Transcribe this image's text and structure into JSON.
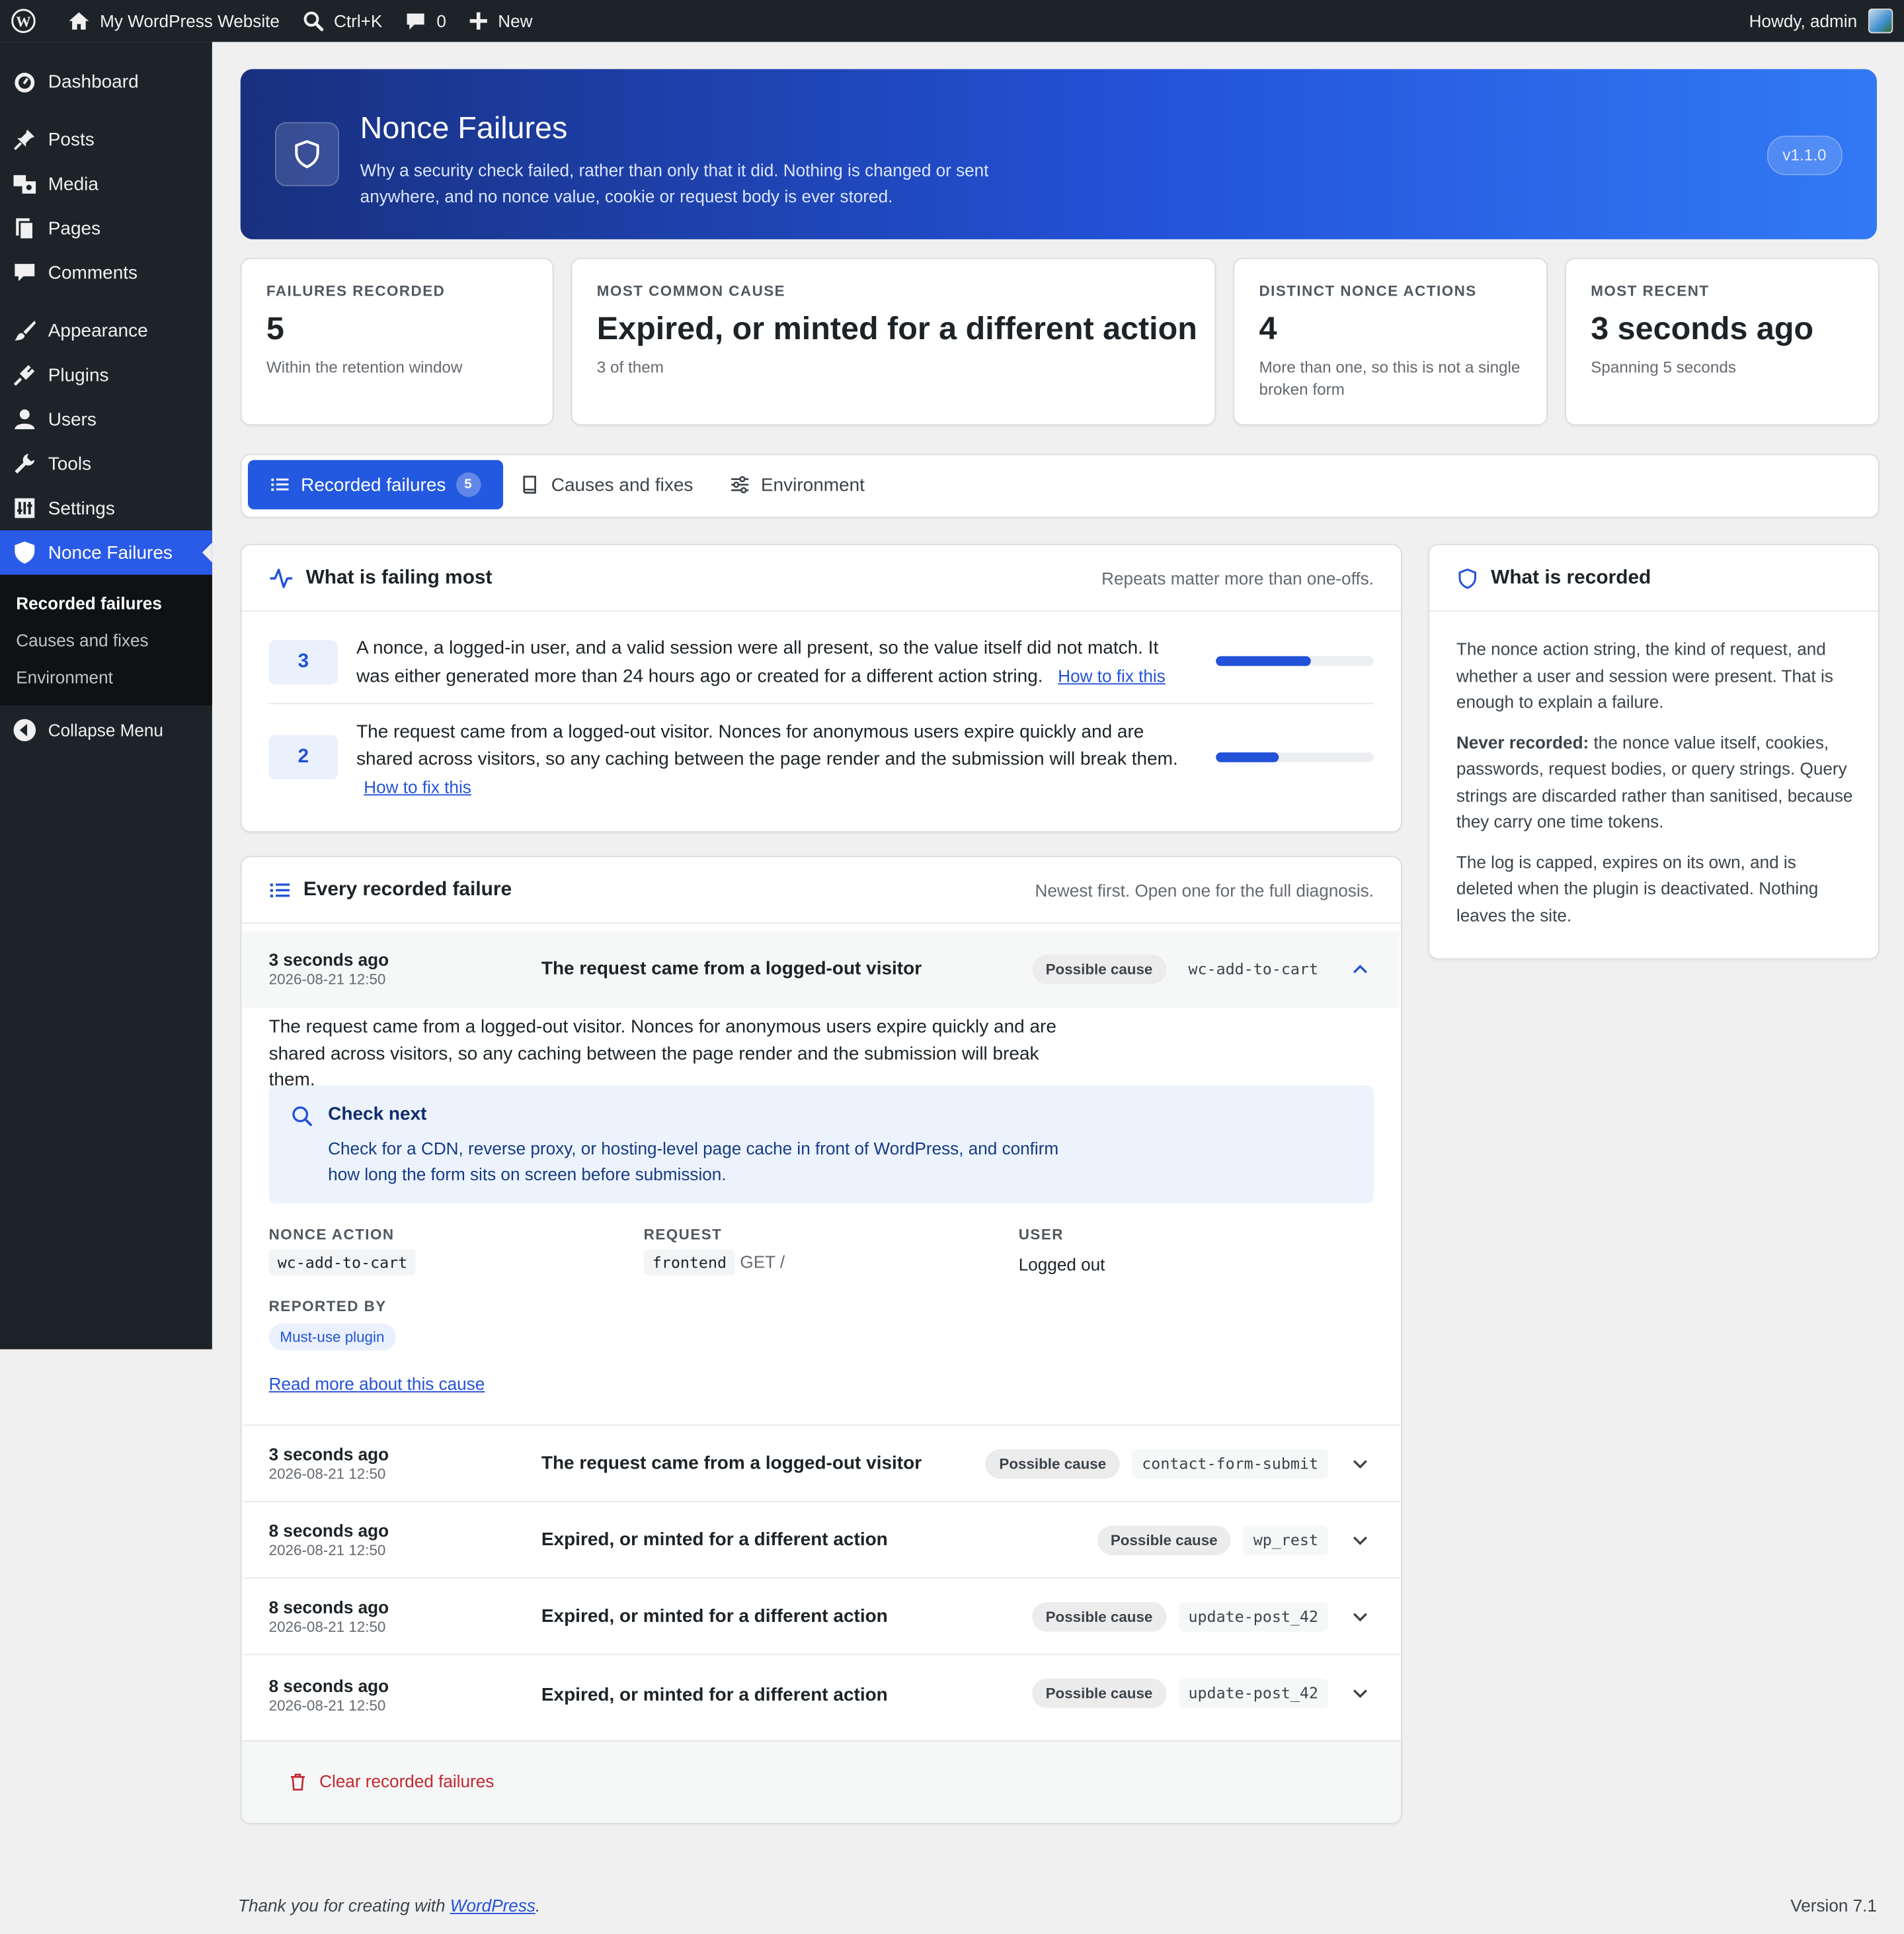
{
  "adminbar": {
    "site_name": "My WordPress Website",
    "search_shortcut": "Ctrl+K",
    "comments_count": "0",
    "new_label": "New",
    "howdy": "Howdy, admin"
  },
  "sidebar": {
    "items": [
      {
        "label": "Dashboard",
        "icon": "dashboard-icon"
      },
      {
        "label": "Posts",
        "icon": "pin-icon"
      },
      {
        "label": "Media",
        "icon": "media-icon"
      },
      {
        "label": "Pages",
        "icon": "pages-icon"
      },
      {
        "label": "Comments",
        "icon": "comment-icon"
      },
      {
        "label": "Appearance",
        "icon": "brush-icon"
      },
      {
        "label": "Plugins",
        "icon": "plug-icon"
      },
      {
        "label": "Users",
        "icon": "user-icon"
      },
      {
        "label": "Tools",
        "icon": "wrench-icon"
      },
      {
        "label": "Settings",
        "icon": "settings-icon"
      },
      {
        "label": "Nonce Failures",
        "icon": "shield-icon"
      }
    ],
    "submenu": [
      "Recorded failures",
      "Causes and fixes",
      "Environment"
    ],
    "collapse_label": "Collapse Menu"
  },
  "hero": {
    "title": "Nonce Failures",
    "description": "Why a security check failed, rather than only that it did. Nothing is changed or sent anywhere, and no nonce value, cookie or request body is ever stored.",
    "version": "v1.1.0"
  },
  "stats": [
    {
      "label": "FAILURES RECORDED",
      "value": "5",
      "sub": "Within the retention window"
    },
    {
      "label": "MOST COMMON CAUSE",
      "value": "Expired, or minted for a different action",
      "sub": "3 of them"
    },
    {
      "label": "DISTINCT NONCE ACTIONS",
      "value": "4",
      "sub": "More than one, so this is not a single broken form"
    },
    {
      "label": "MOST RECENT",
      "value": "3 seconds ago",
      "sub": "Spanning 5 seconds"
    }
  ],
  "tabs": {
    "recorded": "Recorded failures",
    "recorded_count": "5",
    "causes": "Causes and fixes",
    "environment": "Environment"
  },
  "failing_most": {
    "title": "What is failing most",
    "note": "Repeats matter more than one-offs.",
    "rows": [
      {
        "count": "3",
        "text": "A nonce, a logged-in user, and a valid session were all present, so the value itself did not match. It was either generated more than 24 hours ago or created for a different action string.",
        "link": "How to fix this",
        "share": 0.6
      },
      {
        "count": "2",
        "text": "The request came from a logged-out visitor. Nonces for anonymous users expire quickly and are shared across visitors, so any caching between the page render and the submission will break them.",
        "link": "How to fix this",
        "share": 0.4
      }
    ]
  },
  "recorded_panel": {
    "title": "What is recorded",
    "p1": "The nonce action string, the kind of request, and whether a user and session were present. That is enough to explain a failure.",
    "p2_strong": "Never recorded:",
    "p2_rest": " the nonce value itself, cookies, passwords, request bodies, or query strings. Query strings are discarded rather than sanitised, because they carry one time tokens.",
    "p3": "The log is capped, expires on its own, and is deleted when the plugin is deactivated. Nothing leaves the site."
  },
  "every_failure": {
    "title": "Every recorded failure",
    "note": "Newest first. Open one for the full diagnosis.",
    "expanded": {
      "when": "3 seconds ago",
      "date": "2026-08-21 12:50",
      "title": "The request came from a logged-out visitor",
      "pill": "Possible cause",
      "action": "wc-add-to-cart",
      "explanation": "The request came from a logged-out visitor. Nonces for anonymous users expire quickly and are shared across visitors, so any caching between the page render and the submission will break them.",
      "check_title": "Check next",
      "check_text": "Check for a CDN, reverse proxy, or hosting-level page cache in front of WordPress, and confirm how long the form sits on screen before submission.",
      "nonce_action_label": "NONCE ACTION",
      "nonce_action": "wc-add-to-cart",
      "request_label": "REQUEST",
      "request_code": "frontend",
      "request_method": "GET /",
      "user_label": "USER",
      "user_value": "Logged out",
      "reported_label": "REPORTED BY",
      "reported_value": "Must-use plugin",
      "read_more": "Read more about this cause"
    },
    "rows": [
      {
        "when": "3 seconds ago",
        "date": "2026-08-21 12:50",
        "title": "The request came from a logged-out visitor",
        "pill": "Possible cause",
        "action": "contact-form-submit"
      },
      {
        "when": "8 seconds ago",
        "date": "2026-08-21 12:50",
        "title": "Expired, or minted for a different action",
        "pill": "Possible cause",
        "action": "wp_rest"
      },
      {
        "when": "8 seconds ago",
        "date": "2026-08-21 12:50",
        "title": "Expired, or minted for a different action",
        "pill": "Possible cause",
        "action": "update-post_42"
      },
      {
        "when": "8 seconds ago",
        "date": "2026-08-21 12:50",
        "title": "Expired, or minted for a different action",
        "pill": "Possible cause",
        "action": "update-post_42"
      }
    ],
    "clear_label": "Clear recorded failures"
  },
  "footer": {
    "thanks_prefix": "Thank you for creating with ",
    "thanks_link": "WordPress",
    "thanks_suffix": ".",
    "version": "Version 7.1"
  },
  "colors": {
    "accent": "#2352d8",
    "sidebar": "#1d2327",
    "danger": "#d63638"
  }
}
